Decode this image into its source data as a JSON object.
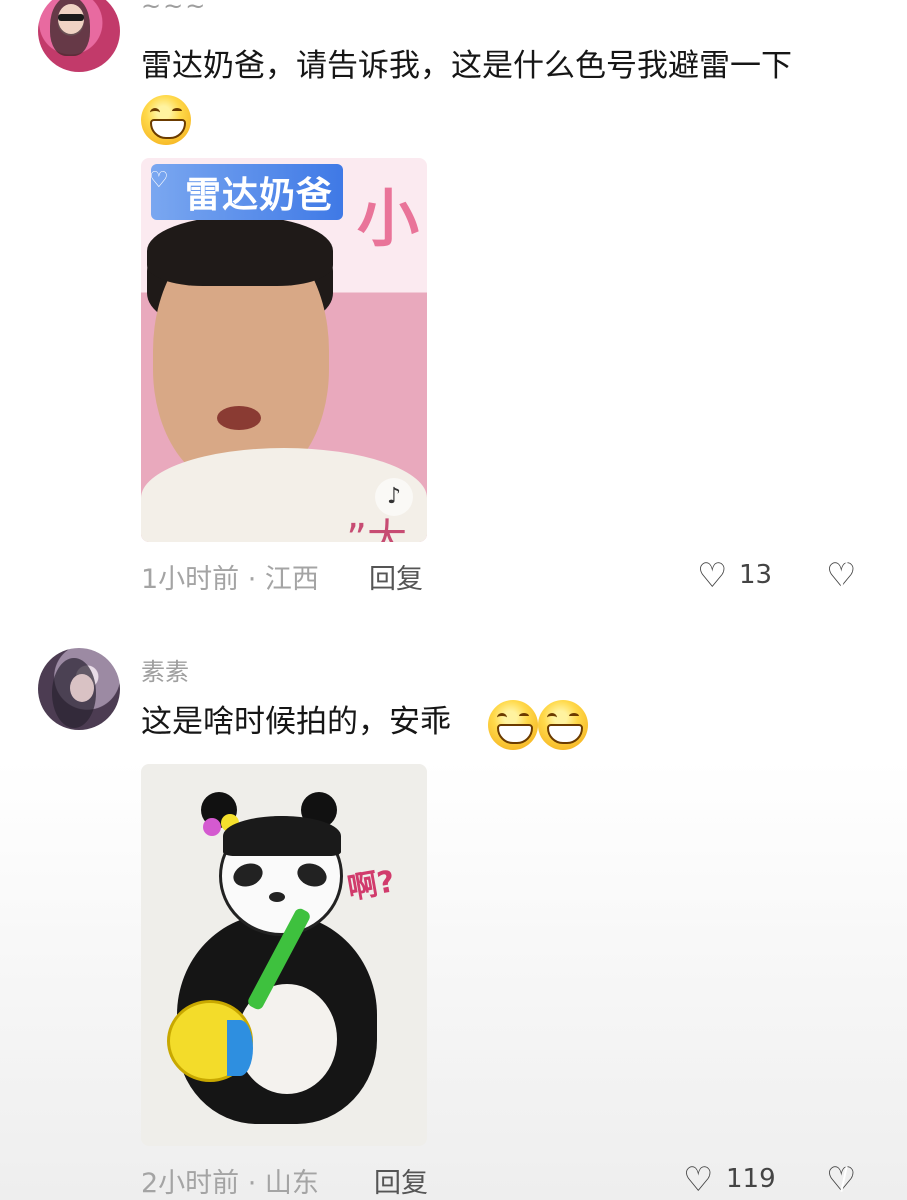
{
  "comments": [
    {
      "username": "~~~",
      "text": "雷达奶爸，请告诉我，这是什么色号我避雷一下",
      "emojis": [
        "grinning-emoji"
      ],
      "image": {
        "badge_text": "雷达奶爸",
        "deco_text": "小",
        "quote_text": "”大"
      },
      "meta": "1小时前 · 江西",
      "reply_label": "回复",
      "like_count": "13"
    },
    {
      "username": "素素",
      "text": "这是啥时候拍的，安乖",
      "emojis": [
        "grinning-emoji",
        "grinning-emoji"
      ],
      "image": {
        "speech_text": "啊?"
      },
      "meta": "2小时前 · 山东",
      "reply_label": "回复",
      "like_count": "119"
    }
  ],
  "colors": {
    "text_primary": "#161616",
    "text_secondary": "#a4a4a4",
    "badge_blue": "#3f79e6",
    "pink": "#e7688f"
  }
}
